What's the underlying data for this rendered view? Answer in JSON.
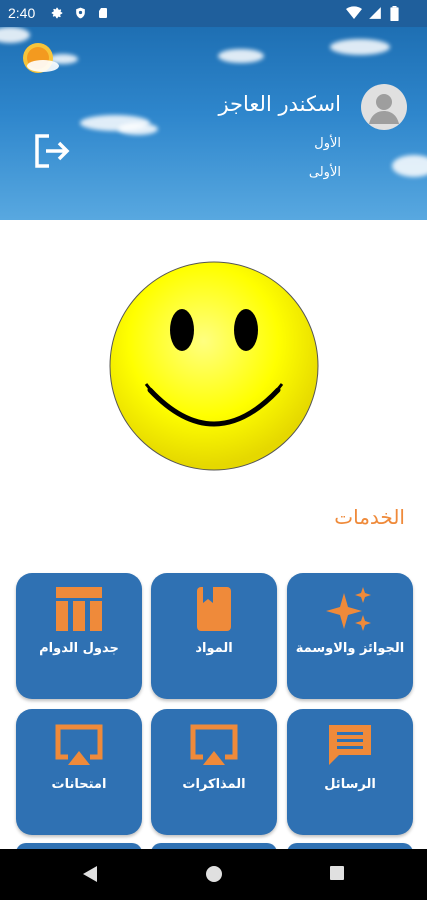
{
  "status_bar": {
    "time": "2:40"
  },
  "header": {
    "user_name": "اسكندر العاجز",
    "line1": "الأول",
    "line2": "الأولى"
  },
  "services": {
    "title": "الخدمات"
  },
  "tiles": [
    {
      "label": "الجوائز والاوسمة",
      "icon": "sparkle-stars-icon"
    },
    {
      "label": "المواد",
      "icon": "book-icon"
    },
    {
      "label": "جدول الدوام",
      "icon": "timetable-icon"
    },
    {
      "label": "الرسائل",
      "icon": "message-icon"
    },
    {
      "label": "المذاكرات",
      "icon": "cast-screen-icon"
    },
    {
      "label": "امتحانات",
      "icon": "cast-screen-icon"
    }
  ],
  "colors": {
    "tile_bg": "#2f71b3",
    "accent_orange": "#ef8a3a",
    "header_blue": "#2e86cc"
  }
}
